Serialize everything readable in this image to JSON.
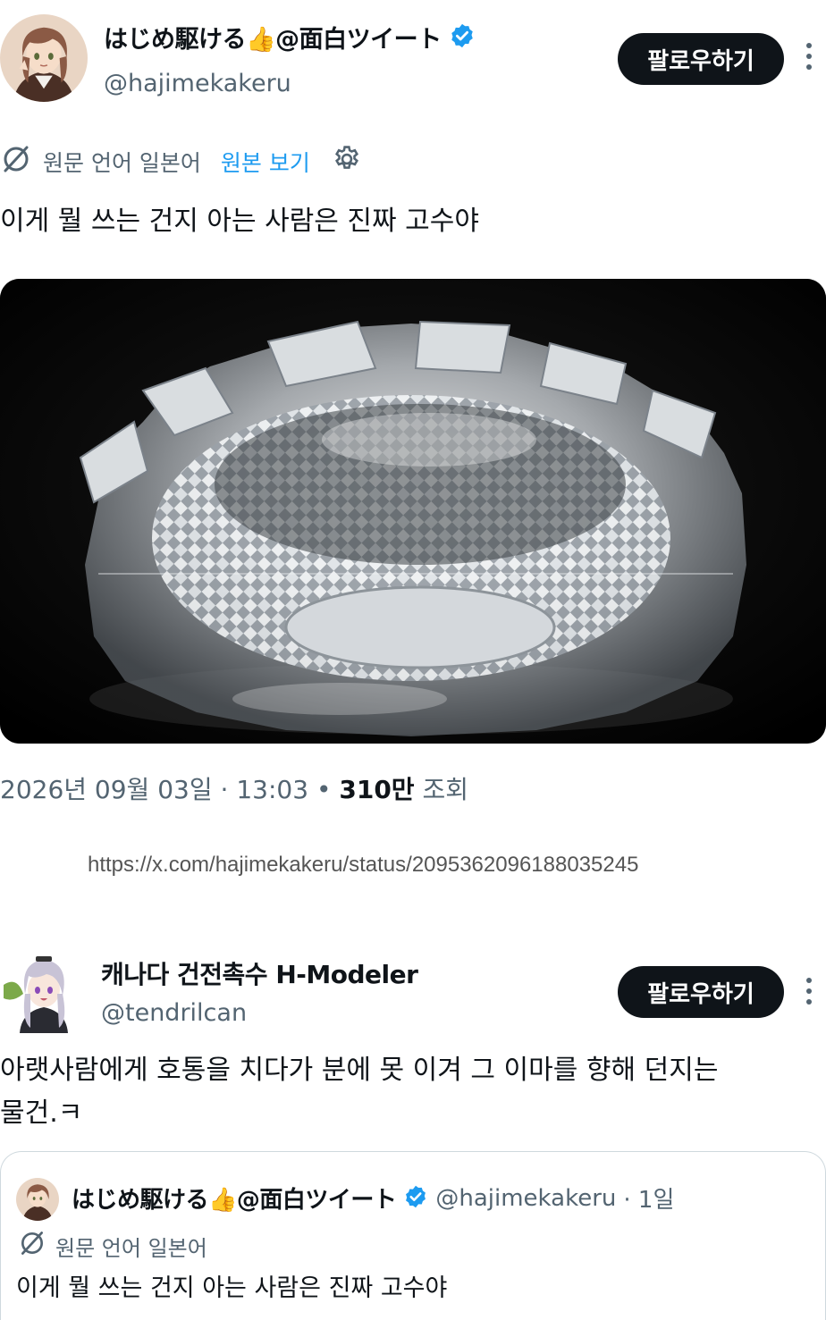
{
  "tweet": {
    "author_name": "はじめ駆ける👍@面白ツイート",
    "author_handle": "@hajimekakeru",
    "follow_label": "팔로우하기",
    "translation_note": "원문 언어 일본어",
    "view_original_label": "원본 보기",
    "text": "이게 뭘 쓰는 건지 아는 사람은 진짜 고수야",
    "date": "2026년 09월 03일",
    "time": "13:03",
    "views_count": "310만",
    "views_label": "조회",
    "url": "https://x.com/hajimekakeru/status/2095362096188035245"
  },
  "reply": {
    "author_name": "캐나다 건전촉수 H-Modeler",
    "author_handle": "@tendrilcan",
    "follow_label": "팔로우하기",
    "text_line1": "아랫사람에게 호통을 치다가 분에 못 이겨 그 이마를 향해 던지는",
    "text_line2": "물건.ㅋ"
  },
  "quote": {
    "author_name": "はじめ駆ける👍@面白ツイート",
    "author_handle": "@hajimekakeru",
    "age": "· 1일",
    "translation_note": "원문 언어 일본어",
    "text": "이게 뭘 쓰는 건지 아는 사람은 진짜 고수야"
  },
  "colors": {
    "text_primary": "#0f1419",
    "text_secondary": "#536471",
    "link": "#1d9bf0",
    "verified": "#1d9bf0",
    "button_bg": "#0f1419"
  },
  "icons": [
    "verified-badge-icon",
    "translate-icon",
    "gear-icon",
    "more-icon"
  ]
}
